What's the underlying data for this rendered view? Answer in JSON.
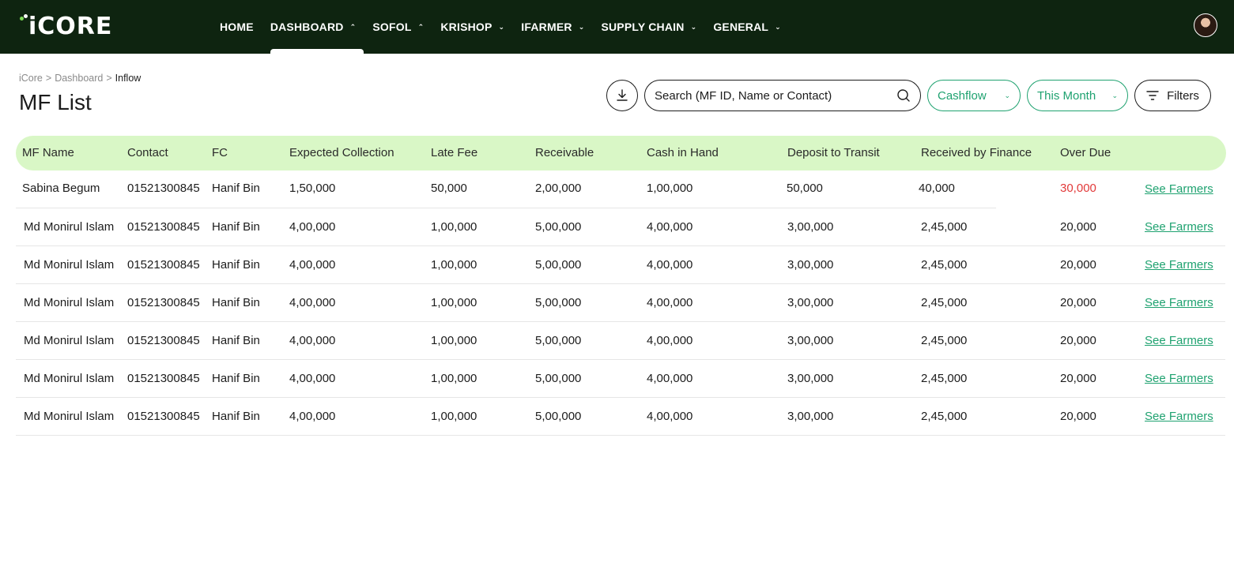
{
  "brand": {
    "name": "iCORE",
    "dot_colors": [
      "#7ed957",
      "#ffffff",
      "#7ed957"
    ]
  },
  "nav": {
    "items": [
      {
        "label": "HOME",
        "has_chevron": false,
        "chevron": ""
      },
      {
        "label": "DASHBOARD",
        "has_chevron": true,
        "chevron": "up",
        "active": true
      },
      {
        "label": "SOFOL",
        "has_chevron": true,
        "chevron": "up"
      },
      {
        "label": "KRISHOP",
        "has_chevron": true,
        "chevron": "down"
      },
      {
        "label": "IFARMER",
        "has_chevron": true,
        "chevron": "down"
      },
      {
        "label": "SUPPLY CHAIN",
        "has_chevron": true,
        "chevron": "down"
      },
      {
        "label": "GENERAL",
        "has_chevron": true,
        "chevron": "down"
      }
    ]
  },
  "breadcrumb": {
    "items": [
      "iCore",
      "Dashboard"
    ],
    "separator": ">",
    "current": "Inflow"
  },
  "page_title": "MF List",
  "toolbar": {
    "download_icon": "download-icon",
    "search_placeholder": "Search (MF ID, Name or Contact)",
    "cashflow_label": "Cashflow",
    "period_label": "This Month",
    "filters_label": "Filters"
  },
  "colors": {
    "topbar": "#0e2410",
    "accent": "#1fa270",
    "header_row": "#d9f7c6",
    "overdue": "#e23a3a"
  },
  "table": {
    "columns": [
      "MF Name",
      "Contact",
      "FC",
      "Expected Collection",
      "Late Fee",
      "Receivable",
      "Cash in Hand",
      "Deposit to Transit",
      "Received by Finance",
      "Over Due"
    ],
    "action_label": "See Farmers",
    "rows": [
      {
        "mf_name": "Sabina Begum",
        "contact": "01521300845",
        "fc": "Hanif Bin",
        "expected": "1,50,000",
        "late_fee": "50,000",
        "receivable": "2,00,000",
        "cash_in_hand": "1,00,000",
        "deposit": "50,000",
        "received": "40,000",
        "over_due": "30,000",
        "highlight": true
      },
      {
        "mf_name": "Md Monirul Islam",
        "contact": "01521300845",
        "fc": "Hanif Bin",
        "expected": "4,00,000",
        "late_fee": "1,00,000",
        "receivable": "5,00,000",
        "cash_in_hand": "4,00,000",
        "deposit": "3,00,000",
        "received": "2,45,000",
        "over_due": "20,000",
        "highlight": false
      },
      {
        "mf_name": "Md Monirul Islam",
        "contact": "01521300845",
        "fc": "Hanif Bin",
        "expected": "4,00,000",
        "late_fee": "1,00,000",
        "receivable": "5,00,000",
        "cash_in_hand": "4,00,000",
        "deposit": "3,00,000",
        "received": "2,45,000",
        "over_due": "20,000",
        "highlight": false
      },
      {
        "mf_name": "Md Monirul Islam",
        "contact": "01521300845",
        "fc": "Hanif Bin",
        "expected": "4,00,000",
        "late_fee": "1,00,000",
        "receivable": "5,00,000",
        "cash_in_hand": "4,00,000",
        "deposit": "3,00,000",
        "received": "2,45,000",
        "over_due": "20,000",
        "highlight": false
      },
      {
        "mf_name": "Md Monirul Islam",
        "contact": "01521300845",
        "fc": "Hanif Bin",
        "expected": "4,00,000",
        "late_fee": "1,00,000",
        "receivable": "5,00,000",
        "cash_in_hand": "4,00,000",
        "deposit": "3,00,000",
        "received": "2,45,000",
        "over_due": "20,000",
        "highlight": false
      },
      {
        "mf_name": "Md Monirul Islam",
        "contact": "01521300845",
        "fc": "Hanif Bin",
        "expected": "4,00,000",
        "late_fee": "1,00,000",
        "receivable": "5,00,000",
        "cash_in_hand": "4,00,000",
        "deposit": "3,00,000",
        "received": "2,45,000",
        "over_due": "20,000",
        "highlight": false
      },
      {
        "mf_name": "Md Monirul Islam",
        "contact": "01521300845",
        "fc": "Hanif Bin",
        "expected": "4,00,000",
        "late_fee": "1,00,000",
        "receivable": "5,00,000",
        "cash_in_hand": "4,00,000",
        "deposit": "3,00,000",
        "received": "2,45,000",
        "over_due": "20,000",
        "highlight": false
      }
    ]
  }
}
